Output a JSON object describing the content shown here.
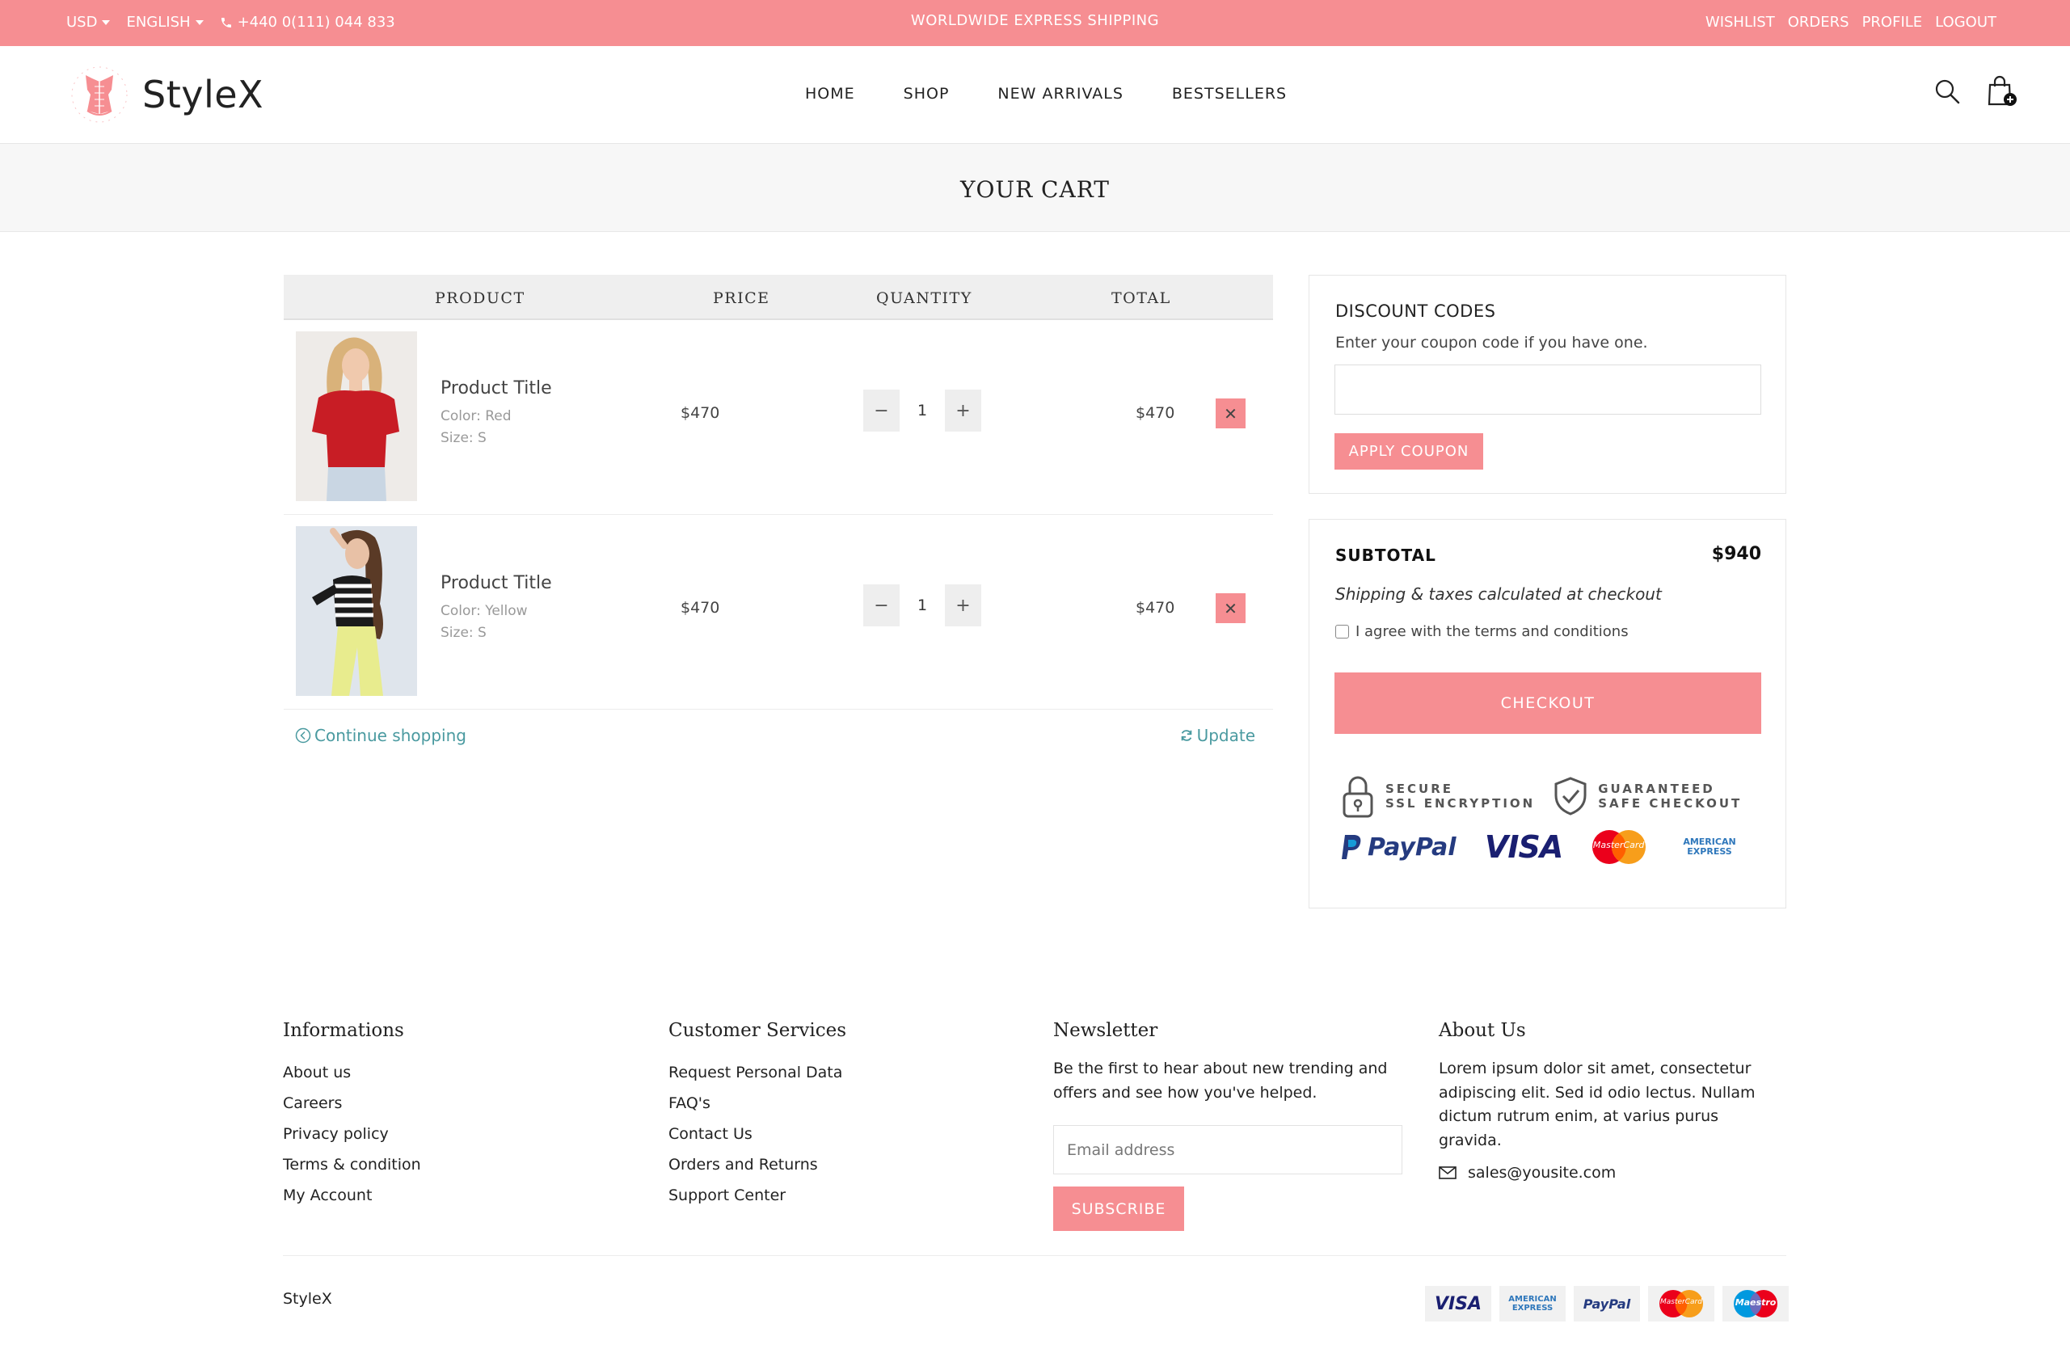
{
  "topbar": {
    "currency": "USD",
    "language": "ENGLISH",
    "phone": "+440 0(111) 044 833",
    "promo": "WORLDWIDE EXPRESS SHIPPING",
    "links": [
      "WISHLIST",
      "ORDERS",
      "PROFILE",
      "LOGOUT"
    ]
  },
  "header": {
    "brand": "StyleX",
    "nav": [
      "HOME",
      "SHOP",
      "NEW ARRIVALS",
      "BESTSELLERS"
    ]
  },
  "page": {
    "title": "YOUR CART"
  },
  "cart": {
    "columns": [
      "PRODUCT",
      "PRICE",
      "QUANTITY",
      "TOTAL"
    ],
    "items": [
      {
        "title": "Product Title",
        "color": "Color: Red",
        "size": "Size: S",
        "price": "$470",
        "quantity": "1",
        "total": "$470"
      },
      {
        "title": "Product Title",
        "color": "Color: Yellow",
        "size": "Size: S",
        "price": "$470",
        "quantity": "1",
        "total": "$470"
      }
    ],
    "continue_label": "Continue shopping",
    "update_label": "Update"
  },
  "discount": {
    "heading": "DISCOUNT CODES",
    "hint": "Enter your coupon code if you have one.",
    "coupon_value": "",
    "apply_label": "APPLY COUPON"
  },
  "summary": {
    "subtotal_label": "SUBTOTAL",
    "subtotal_value": "$940",
    "note": "Shipping & taxes calculated at checkout",
    "agree_label": "I agree with the terms and conditions",
    "checkout_label": "CHECKOUT",
    "secure_line1": "SECURE",
    "secure_line2": "SSL ENCRYPTION",
    "guaranteed_line1": "GUARANTEED",
    "guaranteed_line2": "SAFE CHECKOUT",
    "payment_logos": [
      "PayPal",
      "VISA",
      "MasterCard",
      "AMERICAN EXPRESS"
    ]
  },
  "footer": {
    "informations": {
      "heading": "Informations",
      "links": [
        "About us",
        "Careers",
        "Privacy policy",
        "Terms & condition",
        "My Account"
      ]
    },
    "services": {
      "heading": "Customer Services",
      "links": [
        "Request Personal Data",
        "FAQ's",
        "Contact Us",
        "Orders and Returns",
        "Support Center"
      ]
    },
    "newsletter": {
      "heading": "Newsletter",
      "text": "Be the first to hear about new trending and offers and see how you've helped.",
      "email_placeholder": "Email address",
      "subscribe_label": "SUBSCRIBE"
    },
    "about": {
      "heading": "About Us",
      "text": "Lorem ipsum dolor sit amet, consectetur adipiscing elit. Sed id odio lectus. Nullam dictum rutrum enim, at varius purus gravida.",
      "email": "sales@yousite.com"
    },
    "brand": "StyleX",
    "cards": [
      "VISA",
      "AMERICAN EXPRESS",
      "PayPal",
      "MasterCard",
      "Maestro"
    ]
  },
  "colors": {
    "accent": "#f68e92",
    "link": "#4a9aa0"
  }
}
